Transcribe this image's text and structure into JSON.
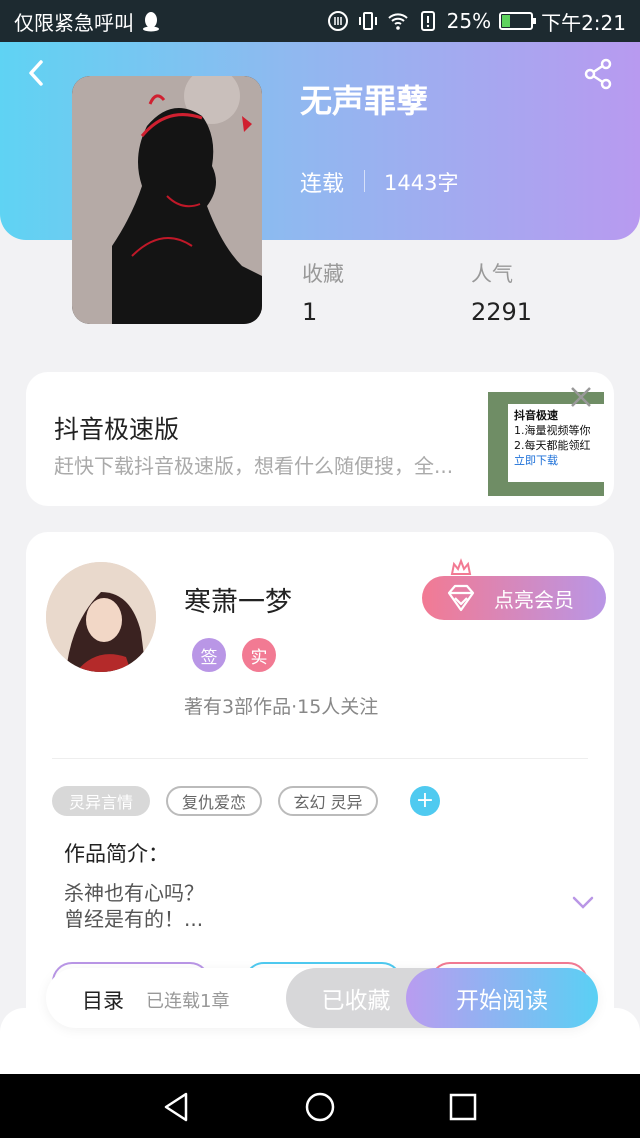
{
  "status_bar": {
    "left_text": "仅限紧急呼叫",
    "battery": "25%",
    "battery_level": 0.25,
    "time": "下午2:21"
  },
  "book": {
    "title": "无声罪孽",
    "status": "连载",
    "word_count": "1443字",
    "stats": [
      {
        "label": "收藏",
        "value": "1"
      },
      {
        "label": "人气",
        "value": "2291"
      }
    ]
  },
  "ad": {
    "title": "抖音极速版",
    "description": "赶快下载抖音极速版，想看什么随便搜，全...",
    "thumb_brand": "抖音极速",
    "thumb_line1": "1.海量视频等你",
    "thumb_line2": "2.每天都能领红",
    "thumb_cta": "立即下载"
  },
  "author": {
    "name": "寒萧一梦",
    "badges": [
      "签",
      "实"
    ],
    "meta": "著有3部作品·15人关注",
    "vip_label": "点亮会员"
  },
  "tags": [
    "灵异言情",
    "复仇爱恋",
    "玄幻 灵异"
  ],
  "intro": {
    "title": "作品简介：",
    "line1": "杀神也有心吗？",
    "line2": "曾经是有的！..."
  },
  "bottom_bar": {
    "toc_label": "目录",
    "toc_count": "已连载1章",
    "collect_label": "已收藏",
    "read_label": "开始阅读"
  },
  "colors": {
    "header_gradient_start": "#5fd3f3",
    "header_gradient_end": "#b89af0",
    "vip_gradient_start": "#f27a93",
    "accent_blue": "#4fcaf0",
    "badge_sign": "#b996e6",
    "badge_real": "#f27a93"
  },
  "icons": [
    "back-arrow-icon",
    "share-icon",
    "close-icon",
    "diamond-icon",
    "crown-icon",
    "plus-icon",
    "chevron-down-icon",
    "nav-back-icon",
    "nav-home-icon",
    "nav-recent-icon"
  ]
}
